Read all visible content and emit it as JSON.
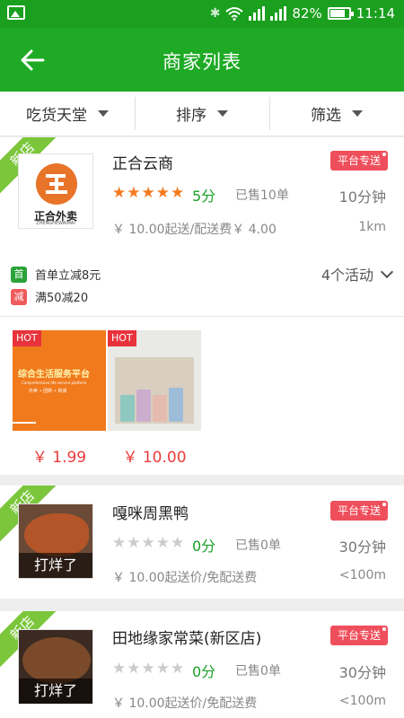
{
  "status_bar": {
    "battery": "82%",
    "time": "11:14"
  },
  "header": {
    "title": "商家列表"
  },
  "filters": [
    {
      "label": "吃货天堂"
    },
    {
      "label": "排序"
    },
    {
      "label": "筛选"
    }
  ],
  "colors": {
    "brand_green": "#1faa25",
    "badge_red": "#ef4f5c",
    "star_orange": "#f47a1f",
    "price_red": "#ea3b3b"
  },
  "merchants": [
    {
      "ribbon": "新店",
      "logo_text": "正合外卖",
      "logo_subtext": "ZHENGHEWAIMAI",
      "name": "正合云商",
      "badge": "平台专送",
      "rating_stars": 5,
      "score": "5分",
      "sold": "已售10单",
      "time": "10分钟",
      "fee": "￥ 10.00起送/配送费￥ 4.00",
      "distance": "1km",
      "promos": [
        {
          "icon": "首",
          "text": "首单立减8元",
          "color": "#2ba33a"
        },
        {
          "icon": "减",
          "text": "满50减20",
          "color": "#ef5a5a"
        }
      ],
      "activities": "4个活动",
      "products": [
        {
          "hot": "HOT",
          "title": "综合生活服务平台",
          "subtitle": "Comprehensive life service platform",
          "tags": "外卖 • 团购 • 商城",
          "price": "￥ 1.99"
        },
        {
          "hot": "HOT",
          "price": "￥ 10.00"
        }
      ]
    },
    {
      "ribbon": "新店",
      "name": "嘎咪周黑鸭",
      "badge": "平台专送",
      "rating_stars": 0,
      "score": "0分",
      "sold": "已售0单",
      "time": "30分钟",
      "fee": "￥ 10.00起送价/免配送费",
      "distance": "<100m",
      "closed_tag": "打烊了"
    },
    {
      "ribbon": "新店",
      "name": "田地缘家常菜(新区店)",
      "badge": "平台专送",
      "rating_stars": 0,
      "score": "0分",
      "sold": "已售0单",
      "time": "30分钟",
      "fee": "￥ 10.00起送价/免配送费",
      "distance": "<100m",
      "closed_tag": "打烊了"
    }
  ]
}
